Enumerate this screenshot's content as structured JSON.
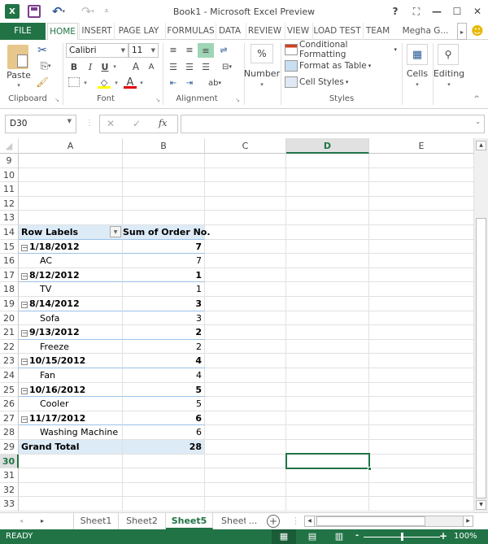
{
  "window": {
    "title": "Book1 - Microsoft Excel Preview",
    "help": "?",
    "controls": [
      "restore-ribbon",
      "minimize",
      "maximize",
      "close"
    ]
  },
  "qat": {
    "app_icon": "excel-icon",
    "save": "save-icon",
    "undo": "undo-icon",
    "redo": "redo-icon",
    "customize": "customize-icon"
  },
  "ribbon_tabs": [
    "FILE",
    "HOME",
    "INSERT",
    "PAGE LAY",
    "FORMULAS",
    "DATA",
    "REVIEW",
    "VIEW",
    "LOAD TEST",
    "TEAM"
  ],
  "active_tab": "HOME",
  "user": "Megha G...",
  "ribbon": {
    "clipboard": {
      "label": "Clipboard",
      "paste": "Paste"
    },
    "font": {
      "label": "Font",
      "name": "Calibri",
      "size": "11",
      "bold": "B",
      "italic": "I",
      "underline": "U",
      "grow": "A",
      "shrink": "A",
      "fill_color": "#ffff00",
      "font_color": "#e00000"
    },
    "alignment": {
      "label": "Alignment"
    },
    "number": {
      "label": "Number",
      "symbol": "%"
    },
    "styles": {
      "label": "Styles",
      "conditional": "Conditional Formatting",
      "format_table": "Format as Table",
      "cell_styles": "Cell Styles"
    },
    "cells": {
      "label": "Cells"
    },
    "editing": {
      "label": "Editing"
    }
  },
  "formula_bar": {
    "name_box": "D30",
    "fx": "fx",
    "value": ""
  },
  "columns": [
    "A",
    "B",
    "C",
    "D",
    "E"
  ],
  "selected_column": "D",
  "selected_row": "30",
  "rows": [
    {
      "n": "9",
      "a": "",
      "b": "",
      "type": "empty"
    },
    {
      "n": "10",
      "a": "",
      "b": "",
      "type": "empty"
    },
    {
      "n": "11",
      "a": "",
      "b": "",
      "type": "empty"
    },
    {
      "n": "12",
      "a": "",
      "b": "",
      "type": "empty"
    },
    {
      "n": "13",
      "a": "",
      "b": "",
      "type": "empty"
    },
    {
      "n": "14",
      "a": "Row Labels",
      "b": "Sum of Order No.",
      "type": "header"
    },
    {
      "n": "15",
      "a": "1/18/2012",
      "b": "7",
      "type": "group"
    },
    {
      "n": "16",
      "a": "AC",
      "b": "7",
      "type": "child"
    },
    {
      "n": "17",
      "a": "8/12/2012",
      "b": "1",
      "type": "group"
    },
    {
      "n": "18",
      "a": "TV",
      "b": "1",
      "type": "child"
    },
    {
      "n": "19",
      "a": "8/14/2012",
      "b": "3",
      "type": "group"
    },
    {
      "n": "20",
      "a": "Sofa",
      "b": "3",
      "type": "child"
    },
    {
      "n": "21",
      "a": "9/13/2012",
      "b": "2",
      "type": "group"
    },
    {
      "n": "22",
      "a": "Freeze",
      "b": "2",
      "type": "child"
    },
    {
      "n": "23",
      "a": "10/15/2012",
      "b": "4",
      "type": "group"
    },
    {
      "n": "24",
      "a": "Fan",
      "b": "4",
      "type": "child"
    },
    {
      "n": "25",
      "a": "10/16/2012",
      "b": "5",
      "type": "group"
    },
    {
      "n": "26",
      "a": "Cooler",
      "b": "5",
      "type": "child"
    },
    {
      "n": "27",
      "a": "11/17/2012",
      "b": "6",
      "type": "group"
    },
    {
      "n": "28",
      "a": "Washing Machine",
      "b": "6",
      "type": "child"
    },
    {
      "n": "29",
      "a": "Grand Total",
      "b": "28",
      "type": "total"
    },
    {
      "n": "30",
      "a": "",
      "b": "",
      "type": "empty"
    },
    {
      "n": "31",
      "a": "",
      "b": "",
      "type": "empty"
    },
    {
      "n": "32",
      "a": "",
      "b": "",
      "type": "empty"
    },
    {
      "n": "33",
      "a": "",
      "b": "",
      "type": "empty"
    }
  ],
  "sheets": [
    "Sheet1",
    "Sheet2",
    "Sheet5",
    "Sheet"
  ],
  "active_sheet": "Sheet5",
  "sheet_more": "...",
  "status": {
    "mode": "READY",
    "zoom": "100%",
    "zoom_minus": "-",
    "zoom_plus": "+"
  }
}
